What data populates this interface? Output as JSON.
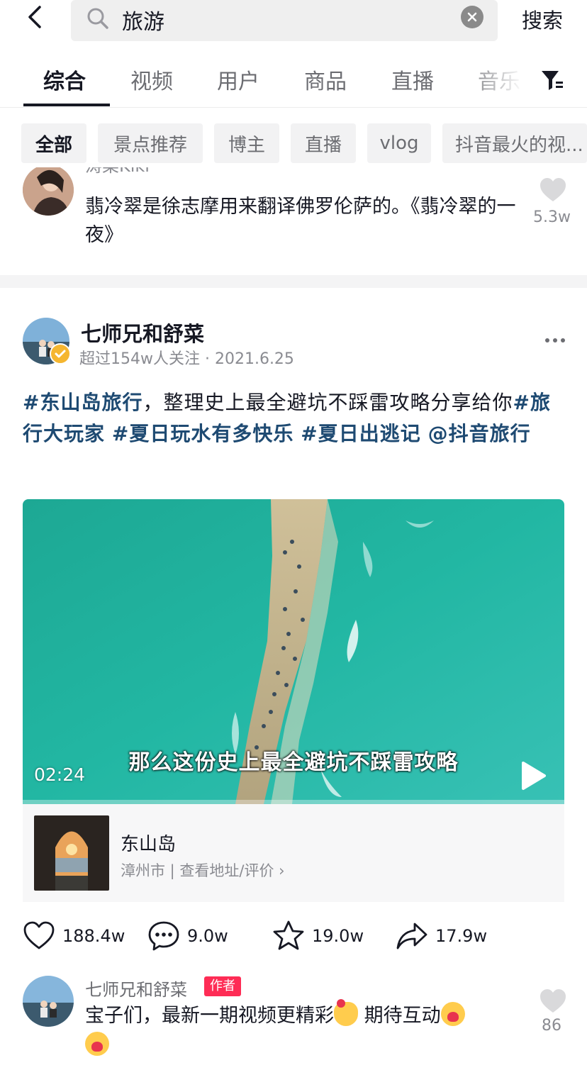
{
  "header": {
    "search_query": "旅游",
    "search_button": "搜索"
  },
  "tabs": [
    "综合",
    "视频",
    "用户",
    "商品",
    "直播",
    "音乐"
  ],
  "chips": [
    "全部",
    "景点推荐",
    "博主",
    "直播",
    "vlog",
    "抖音最火的视..."
  ],
  "prev_comment": {
    "name": "涛菜Kiki",
    "text": "翡冷翠是徐志摩用来翻译佛罗伦萨的。《翡冷翠的一夜》",
    "likes": "5.3w"
  },
  "post": {
    "author": "七师兄和舒菜",
    "meta": "超过154w人关注 · 2021.6.25",
    "text_parts": {
      "t1": "#东山岛旅行",
      "t2": "，整理史上最全避坑不踩雷攻略分享给你",
      "t3": "#旅行大玩家",
      "t4": " ",
      "t5": "#夏日玩水有多快乐",
      "t6": " ",
      "t7": "#夏日出逃记",
      "t8": " ",
      "t9": "@抖音旅行"
    },
    "video": {
      "subtitle": "那么这份史上最全避坑不踩雷攻略",
      "duration": "02:24"
    },
    "location": {
      "name": "东山岛",
      "sub": "漳州市 | 查看地址/评价 ›"
    },
    "stats": {
      "likes": "188.4w",
      "comments": "9.0w",
      "favorites": "19.0w",
      "shares": "17.9w"
    }
  },
  "author_comment": {
    "name": "七师兄和舒菜",
    "badge": "作者",
    "text_a": "宝子们，最新一期视频更精彩",
    "text_b": " 期待互动",
    "likes": "86"
  },
  "colors": {
    "hashtag": "#1e4a72",
    "author_badge": "#fe2c55",
    "verify_badge": "#f5b630",
    "sea": "#1fb5a0"
  }
}
